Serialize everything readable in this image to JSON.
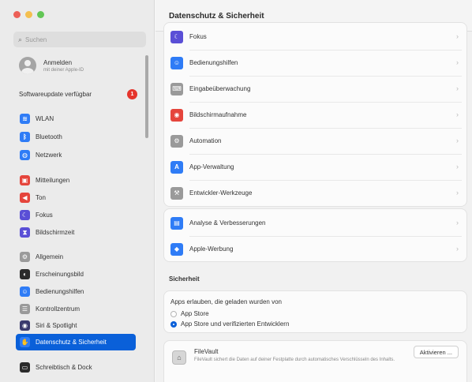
{
  "window": {
    "title": "Datenschutz & Sicherheit"
  },
  "search": {
    "placeholder": "Suchen"
  },
  "account": {
    "name": "Anmelden",
    "subtitle": "mit deiner Apple-ID"
  },
  "update": {
    "label": "Softwareupdate verfügbar",
    "badge": "1"
  },
  "sidebar": {
    "items": [
      {
        "label": "WLAN",
        "icon": "wifi-icon",
        "color": "#2f7cf6",
        "glyph": "≋"
      },
      {
        "label": "Bluetooth",
        "icon": "bluetooth-icon",
        "color": "#2f7cf6",
        "glyph": "ᛒ"
      },
      {
        "label": "Netzwerk",
        "icon": "network-icon",
        "color": "#2f7cf6",
        "glyph": "◍"
      },
      {
        "label": "Mitteilungen",
        "icon": "notifications-icon",
        "color": "#e5453c",
        "glyph": "▣"
      },
      {
        "label": "Ton",
        "icon": "sound-icon",
        "color": "#e5453c",
        "glyph": "◀"
      },
      {
        "label": "Fokus",
        "icon": "focus-icon",
        "color": "#5a4fd6",
        "glyph": "☾"
      },
      {
        "label": "Bildschirmzeit",
        "icon": "screen-time-icon",
        "color": "#5a4fd6",
        "glyph": "⧗"
      },
      {
        "label": "Allgemein",
        "icon": "gear-icon",
        "color": "#9a9a9a",
        "glyph": "⚙"
      },
      {
        "label": "Erscheinungsbild",
        "icon": "appearance-icon",
        "color": "#2b2b2b",
        "glyph": "◐"
      },
      {
        "label": "Bedienungshilfen",
        "icon": "accessibility-icon",
        "color": "#2f7cf6",
        "glyph": "☺"
      },
      {
        "label": "Kontrollzentrum",
        "icon": "control-center-icon",
        "color": "#9a9a9a",
        "glyph": "☰"
      },
      {
        "label": "Siri & Spotlight",
        "icon": "siri-icon",
        "color": "#3a3a6e",
        "glyph": "◉"
      },
      {
        "label": "Datenschutz & Sicherheit",
        "icon": "hand-icon",
        "color": "#2f7cf6",
        "glyph": "✋"
      },
      {
        "label": "Schreibtisch & Dock",
        "icon": "dock-icon",
        "color": "#2b2b2b",
        "glyph": "▭"
      }
    ]
  },
  "main": {
    "rows": [
      {
        "label": "Fokus",
        "icon": "focus-icon",
        "color": "#5a4fd6",
        "glyph": "☾"
      },
      {
        "label": "Bedienungshilfen",
        "icon": "accessibility-icon",
        "color": "#2f7cf6",
        "glyph": "☺"
      },
      {
        "label": "Eingabeüberwachung",
        "icon": "keyboard-icon",
        "color": "#9a9a9a",
        "glyph": "⌨"
      },
      {
        "label": "Bildschirmaufnahme",
        "icon": "screen-recording-icon",
        "color": "#e5453c",
        "glyph": "◉"
      },
      {
        "label": "Automation",
        "icon": "automation-icon",
        "color": "#9a9a9a",
        "glyph": "⚙"
      },
      {
        "label": "App-Verwaltung",
        "icon": "app-store-icon",
        "color": "#2f7cf6",
        "glyph": "A"
      },
      {
        "label": "Entwickler-Werkzeuge",
        "icon": "developer-tools-icon",
        "color": "#9a9a9a",
        "glyph": "⚒"
      }
    ],
    "rows2": [
      {
        "label": "Analyse & Verbesserungen",
        "icon": "analytics-icon",
        "color": "#2f7cf6",
        "glyph": "▤"
      },
      {
        "label": "Apple-Werbung",
        "icon": "advertising-icon",
        "color": "#2f7cf6",
        "glyph": "◆"
      }
    ]
  },
  "security": {
    "title": "Sicherheit",
    "apps_label": "Apps erlauben, die geladen wurden von",
    "options": [
      {
        "label": "App Store",
        "selected": false
      },
      {
        "label": "App Store und verifizierten Entwicklern",
        "selected": true
      }
    ]
  },
  "filevault": {
    "title": "FileVault",
    "description": "FileVault sichert die Daten auf deiner Festplatte durch automatisches Verschlüsseln des Inhalts.",
    "button": "Aktivieren ..."
  }
}
